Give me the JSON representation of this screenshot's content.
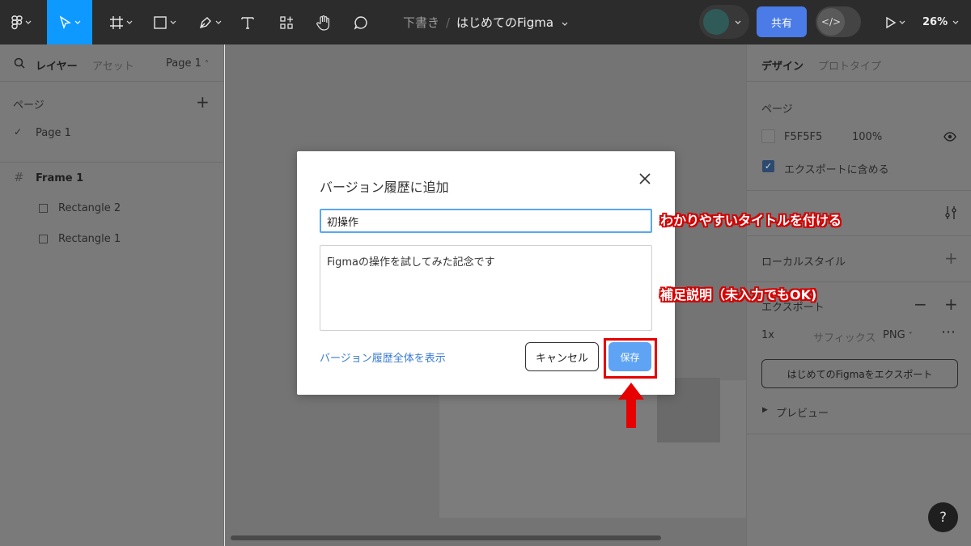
{
  "toolbar": {
    "document": {
      "location": "下書き",
      "separator": "/",
      "file_name": "はじめてのFigma"
    },
    "share_label": "共有",
    "zoom_label": "26%"
  },
  "left_panel": {
    "tabs": {
      "layers": "レイヤー",
      "assets": "アセット"
    },
    "page_selector": "Page 1",
    "pages_heading": "ページ",
    "pages": [
      "Page 1"
    ],
    "layers": {
      "frame": "Frame 1",
      "children": [
        "Rectangle 2",
        "Rectangle 1"
      ]
    }
  },
  "right_panel": {
    "tabs": {
      "design": "デザイン",
      "prototype": "プロトタイプ"
    },
    "page_section": {
      "title": "ページ",
      "color_hex": "F5F5F5",
      "opacity": "100%",
      "include_in_export": "エクスポートに含める"
    },
    "local_styles": "ローカルスタイル",
    "export_section": {
      "title": "エクスポート",
      "scale": "1x",
      "suffix_placeholder": "サフィックス",
      "format": "PNG",
      "export_button": "はじめてのFigmaをエクスポート",
      "preview": "プレビュー"
    }
  },
  "modal": {
    "title": "バージョン履歴に追加",
    "title_input_value": "初操作",
    "description_value": "Figmaの操作を試してみた記念です",
    "view_all_link": "バージョン履歴全体を表示",
    "cancel_label": "キャンセル",
    "save_label": "保存"
  },
  "annotations": {
    "title_tip": "わかりやすいタイトルを付ける",
    "description_tip": "補足説明（未入力でもOK)"
  },
  "colors": {
    "toolbar_bg": "#2c2c2c",
    "active_tool": "#0d99ff",
    "share_button": "#4a7be6",
    "save_button": "#5fa3f5",
    "annotation_red": "#e60000"
  },
  "help_label": "?"
}
